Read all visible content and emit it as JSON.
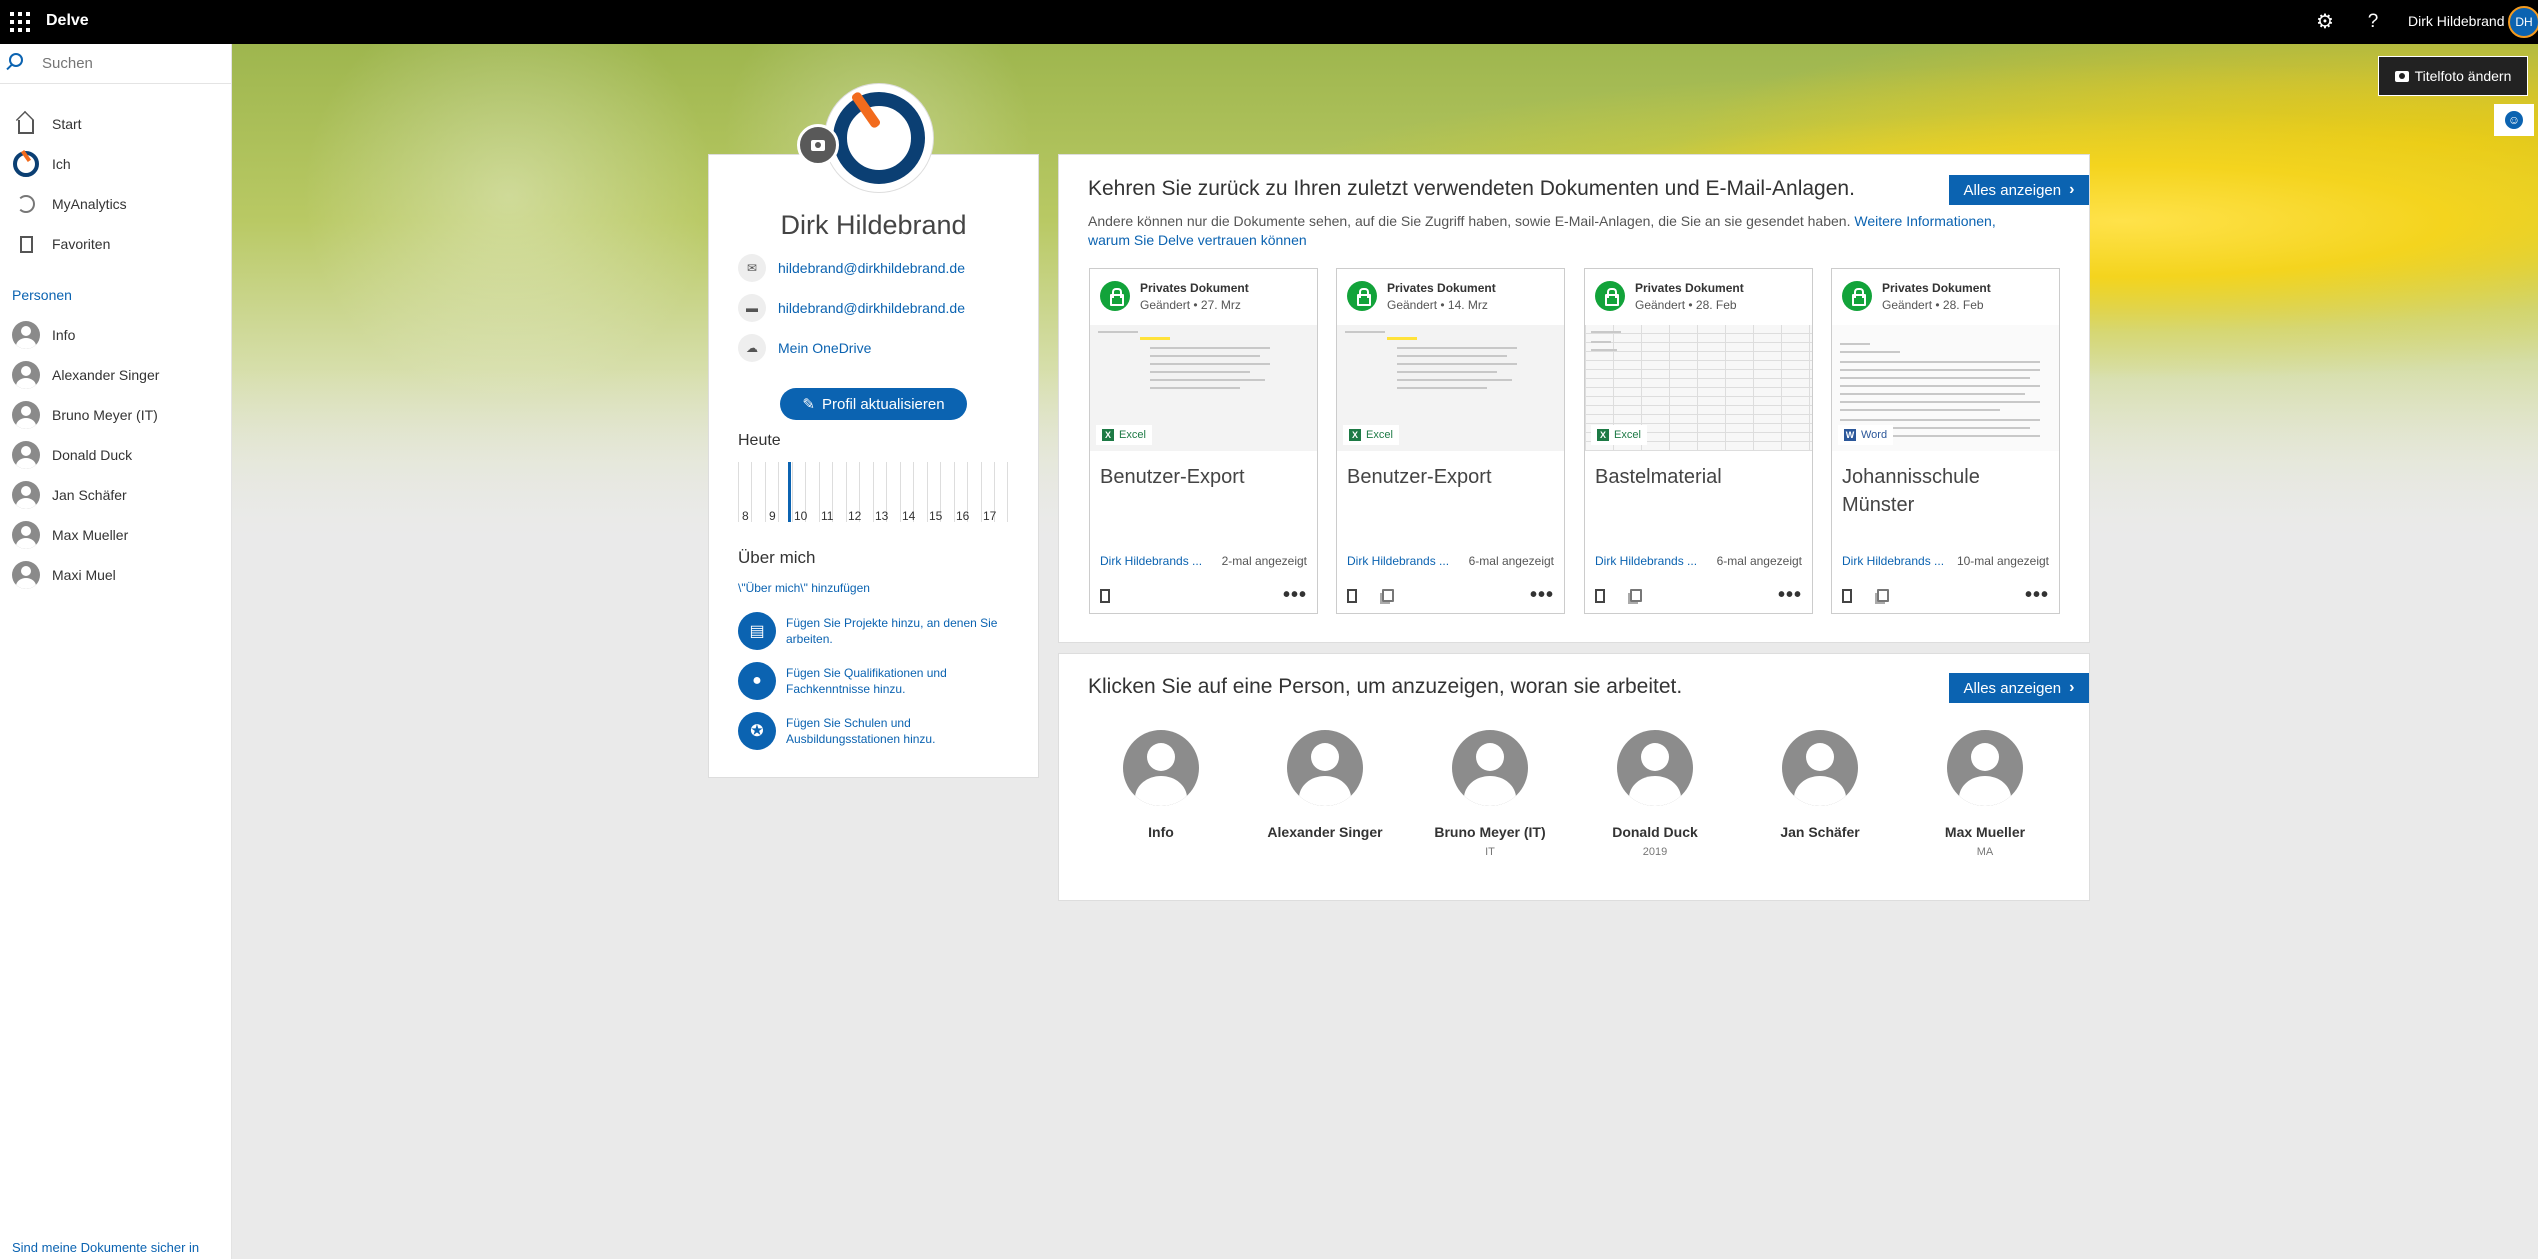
{
  "topbar": {
    "app_title": "Delve",
    "user_name": "Dirk Hildebrand",
    "avatar_initials": "DH",
    "icons": [
      "app-launcher-icon",
      "gear-icon",
      "help-icon"
    ]
  },
  "leftnav": {
    "search_placeholder": "Suchen",
    "items": [
      {
        "label": "Start",
        "icon": "home-icon"
      },
      {
        "label": "Ich",
        "icon": "profile-logo-icon"
      },
      {
        "label": "MyAnalytics",
        "icon": "analytics-icon"
      },
      {
        "label": "Favoriten",
        "icon": "bookmark-icon"
      }
    ],
    "people_heading": "Personen",
    "people": [
      "Info",
      "Alexander Singer",
      "Bruno Meyer (IT)",
      "Donald Duck",
      "Jan Schäfer",
      "Max Mueller",
      "Maxi Muel"
    ],
    "bottom_link": "Sind meine Dokumente sicher in"
  },
  "hero": {
    "cover_button": "Titelfoto ändern"
  },
  "profile": {
    "name": "Dirk Hildebrand",
    "email": "hildebrand@dirkhildebrand.de",
    "chat": "hildebrand@dirkhildebrand.de",
    "onedrive": "Mein OneDrive",
    "update_button": "Profil aktualisieren",
    "today_label": "Heute",
    "hours": [
      "8",
      "9",
      "10",
      "11",
      "12",
      "13",
      "14",
      "15",
      "16",
      "17"
    ],
    "about_title": "Über mich",
    "about_add": "\\\"Über mich\\\" hinzufügen",
    "about_items": [
      "Fügen Sie Projekte hinzu, an denen Sie arbeiten.",
      "Fügen Sie Qualifikationen und Fachkenntnisse hinzu.",
      "Fügen Sie Schulen und Ausbildungsstationen hinzu."
    ]
  },
  "docs": {
    "title": "Kehren Sie zurück zu Ihren zuletzt verwendeten Dokumenten und E-Mail-Anlagen.",
    "show_all": "Alles anzeigen",
    "subtitle": "Andere können nur die Dokumente sehen, auf die Sie Zugriff haben, sowie E-Mail-Anlagen, die Sie an sie gesendet haben.",
    "subtitle_link": "Weitere Informationen, warum Sie Delve vertrauen können",
    "cards": [
      {
        "privacy": "Privates Dokument",
        "changed": "Geändert • 27. Mrz",
        "type": "Excel",
        "title": "Benutzer-Export",
        "owner": "Dirk Hildebrands ...",
        "views": "2-mal angezeigt"
      },
      {
        "privacy": "Privates Dokument",
        "changed": "Geändert • 14. Mrz",
        "type": "Excel",
        "title": "Benutzer-Export",
        "owner": "Dirk Hildebrands ...",
        "views": "6-mal angezeigt"
      },
      {
        "privacy": "Privates Dokument",
        "changed": "Geändert • 28. Feb",
        "type": "Excel",
        "title": "Bastelmaterial",
        "owner": "Dirk Hildebrands ...",
        "views": "6-mal angezeigt"
      },
      {
        "privacy": "Privates Dokument",
        "changed": "Geändert • 28. Feb",
        "type": "Word",
        "title": "Johannisschule Münster",
        "owner": "Dirk Hildebrands ...",
        "views": "10-mal angezeigt"
      }
    ]
  },
  "people": {
    "title": "Klicken Sie auf eine Person, um anzuzeigen, woran sie arbeitet.",
    "show_all": "Alles anzeigen",
    "list": [
      {
        "name": "Info",
        "sub": ""
      },
      {
        "name": "Alexander Singer",
        "sub": ""
      },
      {
        "name": "Bruno Meyer (IT)",
        "sub": "IT"
      },
      {
        "name": "Donald Duck",
        "sub": "2019"
      },
      {
        "name": "Jan Schäfer",
        "sub": ""
      },
      {
        "name": "Max Mueller",
        "sub": "MA"
      }
    ]
  },
  "colors": {
    "accent": "#0b63b1",
    "topbar": "#000000",
    "lock_green": "#12a33a",
    "excel_green": "#1d7a45",
    "word_blue": "#2b579a",
    "logo_orange": "#f26b1d",
    "logo_navy": "#0b3f73"
  }
}
